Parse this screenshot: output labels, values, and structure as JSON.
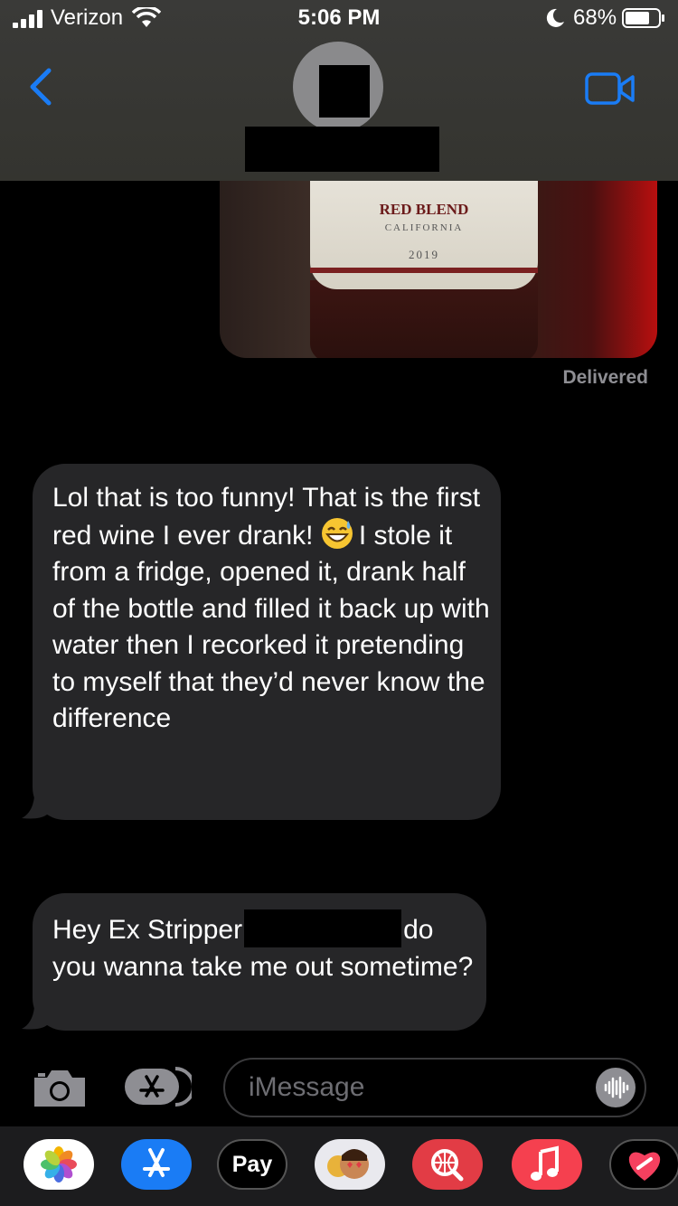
{
  "status_bar": {
    "carrier": "Verizon",
    "time": "5:06 PM",
    "battery": "68%"
  },
  "header": {
    "back_icon": "chevron-left-icon",
    "video_icon": "video-camera-icon"
  },
  "photo": {
    "label_title": "RED BLEND",
    "label_region": "CALIFORNIA",
    "label_year": "2019"
  },
  "delivered": "Delivered",
  "messages": [
    {
      "text_before_emoji": "Lol that is too funny! That is the first red wine I ever drank!",
      "emoji": "grinning-sweat-emoji",
      "text_after_emoji": "I stole it from a fridge, opened it, drank half of the bottle and filled it back up with water then I recorked it pretending to myself that they’d never know the difference"
    },
    {
      "text_before_redaction": "Hey Ex Stripper",
      "text_after_redaction": "do you wanna take me out sometime?"
    }
  ],
  "composer": {
    "placeholder": "iMessage"
  },
  "app_drawer": {
    "pay_label": "Pay",
    "apps": [
      "photos-icon",
      "app-store-icon",
      "apple-pay-icon",
      "memoji-icon",
      "web-search-icon",
      "music-icon",
      "digital-touch-icon"
    ]
  },
  "colors": {
    "ios_blue": "#1a7cf5",
    "bubble_gray": "#262628",
    "header_bg": "#3a3a38"
  }
}
